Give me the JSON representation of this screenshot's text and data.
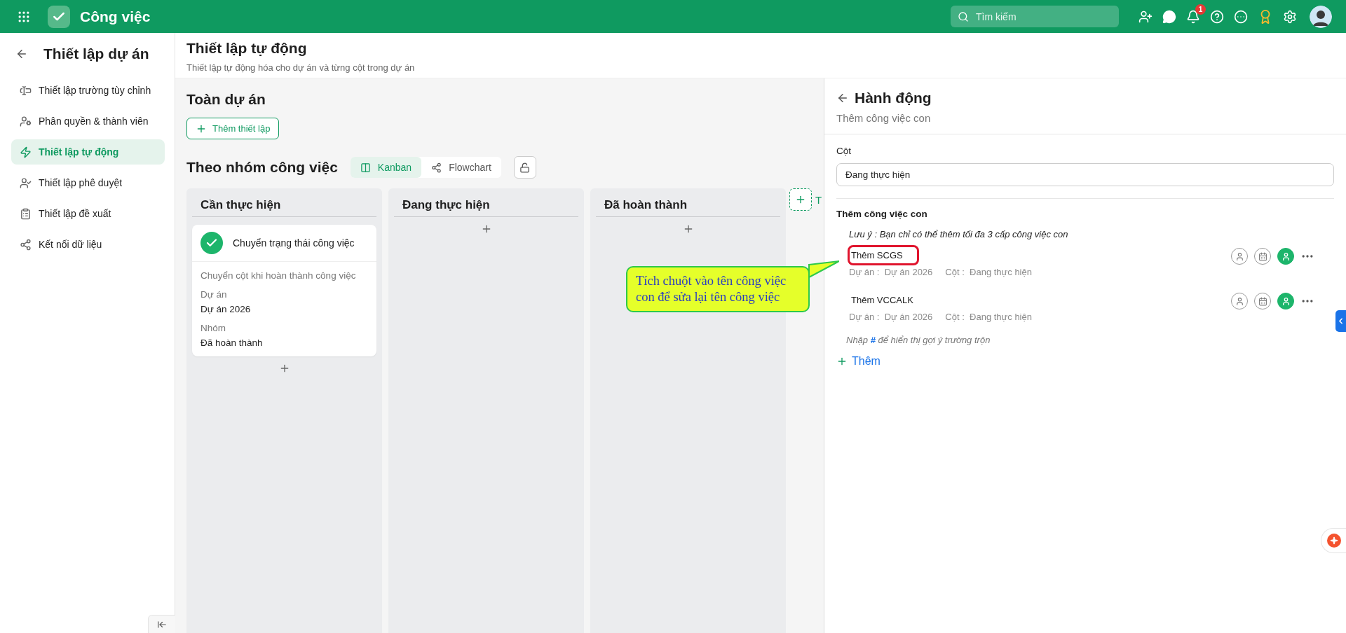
{
  "app": {
    "title": "Công việc",
    "search_placeholder": "Tìm kiếm",
    "notification_count": "1"
  },
  "sidebar": {
    "title": "Thiết lập dự án",
    "items": [
      {
        "label": "Thiết lập trường tùy chỉnh",
        "selected": false
      },
      {
        "label": "Phân quyền & thành viên",
        "selected": false
      },
      {
        "label": "Thiết lập tự động",
        "selected": true
      },
      {
        "label": "Thiết lập phê duyệt",
        "selected": false
      },
      {
        "label": "Thiết lập đề xuất",
        "selected": false
      },
      {
        "label": "Kết nối dữ liệu",
        "selected": false
      }
    ]
  },
  "page": {
    "title": "Thiết lập tự động",
    "subtitle": "Thiết lập tự động hóa cho dự án và từng cột trong dự án"
  },
  "project_section": {
    "title": "Toàn dự án",
    "add_button": "Thêm thiết lập"
  },
  "group_section": {
    "title": "Theo nhóm công việc",
    "view_tabs": [
      {
        "label": "Kanban",
        "selected": true
      },
      {
        "label": "Flowchart",
        "selected": false
      }
    ]
  },
  "columns": [
    {
      "title": "Cần thực hiện",
      "cards": [
        {
          "title": "Chuyển trạng thái công việc",
          "description": "Chuyển cột khi hoàn thành công việc",
          "fields": [
            {
              "label": "Dự án",
              "value": "Dự án 2026"
            },
            {
              "label": "Nhóm",
              "value": "Đã hoàn thành"
            }
          ]
        }
      ]
    },
    {
      "title": "Đang thực hiện"
    },
    {
      "title": "Đã hoàn thành"
    }
  ],
  "add_column_label": "T",
  "panel": {
    "title": "Hành động",
    "subtitle": "Thêm công việc con",
    "column_label": "Cột",
    "column_value": "Đang thực hiện",
    "subtasks_title": "Thêm công việc con",
    "note": "Lưu ý : Bạn chỉ có thể thêm tối đa 3 cấp công việc con",
    "subtasks": [
      {
        "name": "Thêm SCGS",
        "highlighted": true,
        "meta": [
          {
            "label": "Dự án :",
            "value": "Dự án 2026"
          },
          {
            "label": "Cột :",
            "value": "Đang thực hiện"
          }
        ]
      },
      {
        "name": "Thêm VCCALK",
        "highlighted": false,
        "meta": [
          {
            "label": "Dự án :",
            "value": "Dự án 2026"
          },
          {
            "label": "Cột :",
            "value": "Đang thực hiện"
          }
        ]
      }
    ],
    "hint": "Nhập **#** để hiển thị gợi ý trường trộn",
    "add_button": "Thêm"
  },
  "callout": {
    "text": "Tích chuột vào tên công việc con để sửa lại tên công việc"
  }
}
